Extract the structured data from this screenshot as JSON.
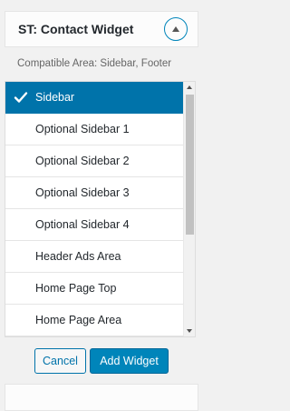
{
  "widget": {
    "title": "ST: Contact Widget",
    "toggle_icon": "chevron-up-icon"
  },
  "compatible_area": "Compatible Area: Sidebar, Footer",
  "sidebar_list": {
    "selected_index": 0,
    "items": [
      {
        "label": "Sidebar",
        "selected": true
      },
      {
        "label": "Optional Sidebar 1",
        "selected": false
      },
      {
        "label": "Optional Sidebar 2",
        "selected": false
      },
      {
        "label": "Optional Sidebar 3",
        "selected": false
      },
      {
        "label": "Optional Sidebar 4",
        "selected": false
      },
      {
        "label": "Header Ads Area",
        "selected": false
      },
      {
        "label": "Home Page Top",
        "selected": false
      },
      {
        "label": "Home Page Area",
        "selected": false
      }
    ]
  },
  "actions": {
    "cancel_label": "Cancel",
    "add_label": "Add Widget"
  },
  "colors": {
    "accent": "#0073aa",
    "primary_button": "#0085ba"
  }
}
